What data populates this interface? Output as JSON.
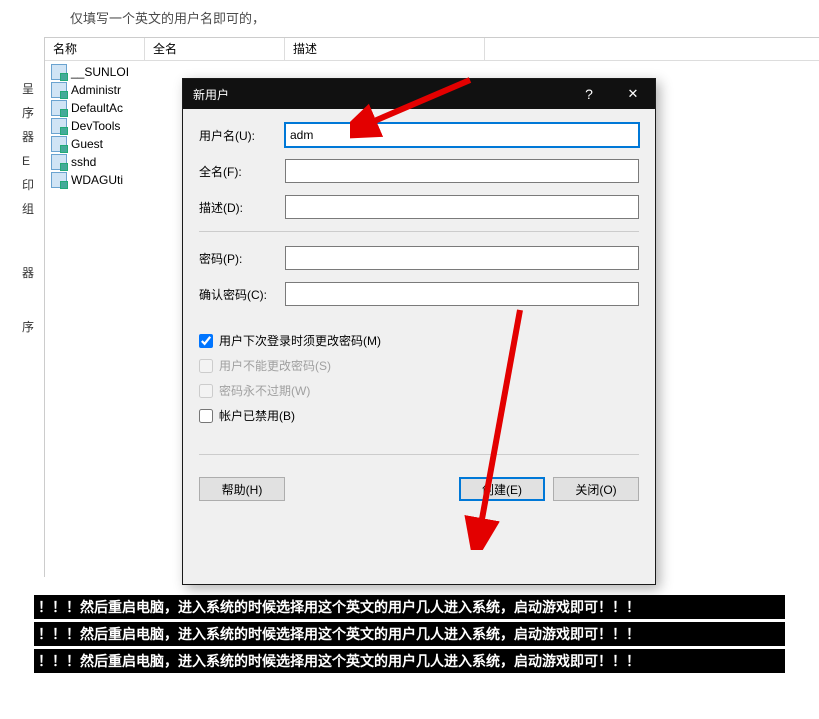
{
  "top_hint": "仅填写一个英文的用户名即可的，",
  "left_fragments": [
    "呈序",
    "器",
    "E",
    "印组",
    "器",
    "序"
  ],
  "list": {
    "cols": {
      "name": "名称",
      "fullname": "全名",
      "desc": "描述"
    },
    "users": [
      "__SUNLOI",
      "Administr",
      "DefaultAc",
      "DevTools",
      "Guest",
      "sshd",
      "WDAGUti"
    ]
  },
  "dialog": {
    "title": "新用户",
    "labels": {
      "username": "用户名(U):",
      "fullname": "全名(F):",
      "desc": "描述(D):",
      "password": "密码(P):",
      "confirm": "确认密码(C):"
    },
    "values": {
      "username": "adm",
      "fullname": "",
      "desc": "",
      "password": "",
      "confirm": ""
    },
    "checks": {
      "must_change": "用户下次登录时须更改密码(M)",
      "cannot_change": "用户不能更改密码(S)",
      "never_expire": "密码永不过期(W)",
      "disabled": "帐户已禁用(B)"
    },
    "buttons": {
      "help": "帮助(H)",
      "create": "创建(E)",
      "close": "关闭(O)"
    }
  },
  "warning": "！！！然后重启电脑，进入系统的时候选择用这个英文的用户几人进入系统，启动游戏即可！！！"
}
